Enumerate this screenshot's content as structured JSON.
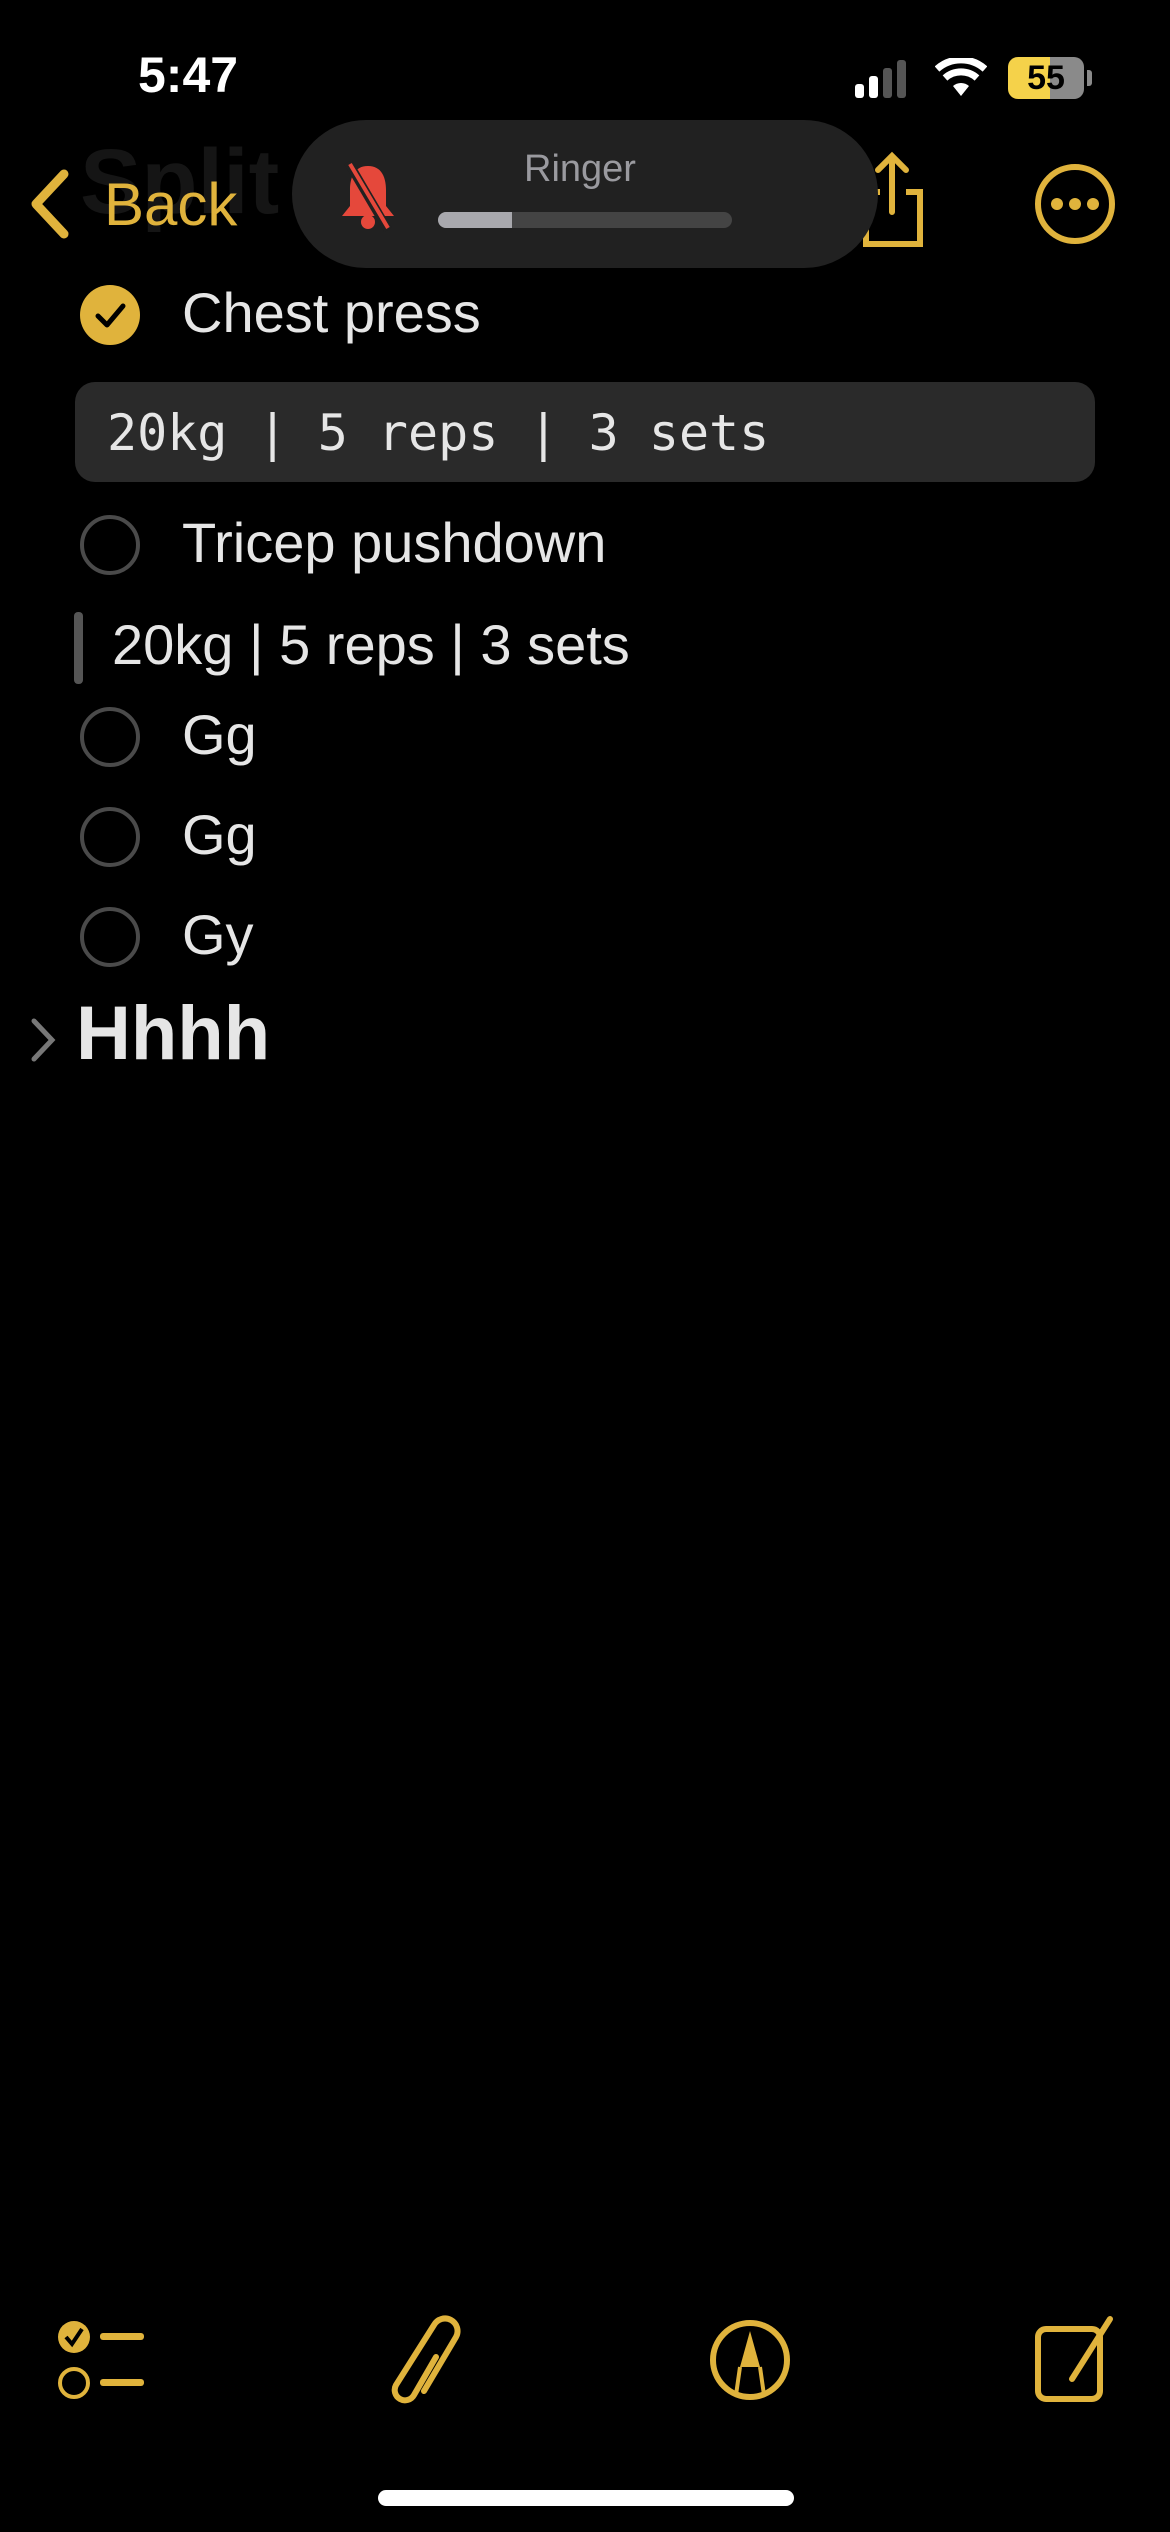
{
  "status_bar": {
    "time": "5:47",
    "battery": "55",
    "signal_bars_active": 2,
    "signal_bars_total": 4
  },
  "nav": {
    "back_label": "Back",
    "title": "Split",
    "share_icon": "share-icon",
    "more_icon": "ellipsis-circle-icon"
  },
  "ringer_hud": {
    "label": "Ringer",
    "muted": true,
    "volume_fraction": 0.25,
    "icon": "bell-slash-icon"
  },
  "note": {
    "items": [
      {
        "type": "checklist",
        "checked": true,
        "text": "Chest press"
      },
      {
        "type": "monospaced",
        "text": "20kg | 5 reps | 3 sets"
      },
      {
        "type": "checklist",
        "checked": false,
        "text": "Tricep pushdown"
      },
      {
        "type": "blockquote",
        "text": "20kg | 5 reps | 3 sets"
      },
      {
        "type": "checklist",
        "checked": false,
        "text": "Gg"
      },
      {
        "type": "checklist",
        "checked": false,
        "text": "Gg"
      },
      {
        "type": "checklist",
        "checked": false,
        "text": "Gy"
      },
      {
        "type": "collapsed-heading",
        "text": "Hhhh"
      }
    ]
  },
  "toolbar": {
    "icons": [
      "checklist-icon",
      "paperclip-icon",
      "markup-pen-icon",
      "compose-icon"
    ]
  },
  "colors": {
    "accent": "#e0b33c",
    "background": "#000000",
    "muted_bell": "#e5483b"
  }
}
